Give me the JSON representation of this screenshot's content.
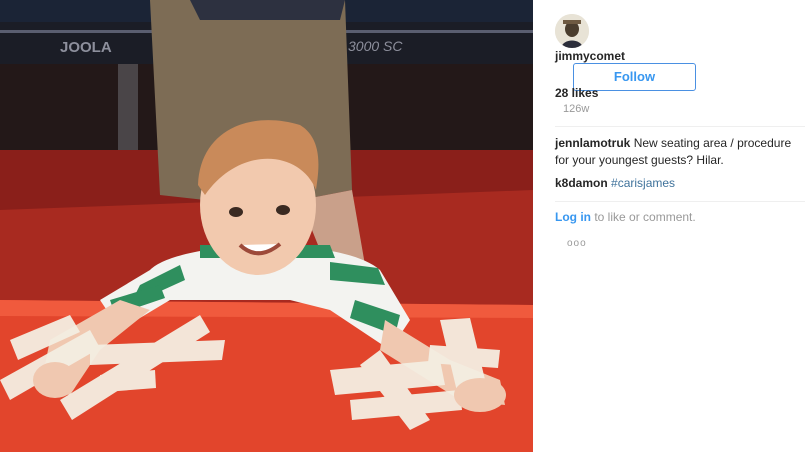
{
  "photo": {
    "alt_icon": "photo-content",
    "table_brand": "JOOLA",
    "table_model": "3000 SC"
  },
  "post": {
    "username": "jimmycomet",
    "follow_label": "Follow",
    "likes": "28 likes",
    "time_ago": "126w",
    "caption": {
      "author": "jennlamotruk",
      "text": "New seating area / procedure for your youngest guests? Hilar."
    },
    "comment": {
      "author": "k8damon",
      "hashtag": "#carisjames"
    },
    "login": {
      "link_label": "Log in",
      "rest_text": "to like or comment."
    },
    "more_icon": "more-options-icon",
    "more_label": "ooo"
  },
  "colors": {
    "link_blue": "#3897f0",
    "hashtag_blue": "#3f729b",
    "text": "#262626",
    "muted": "#999999"
  }
}
